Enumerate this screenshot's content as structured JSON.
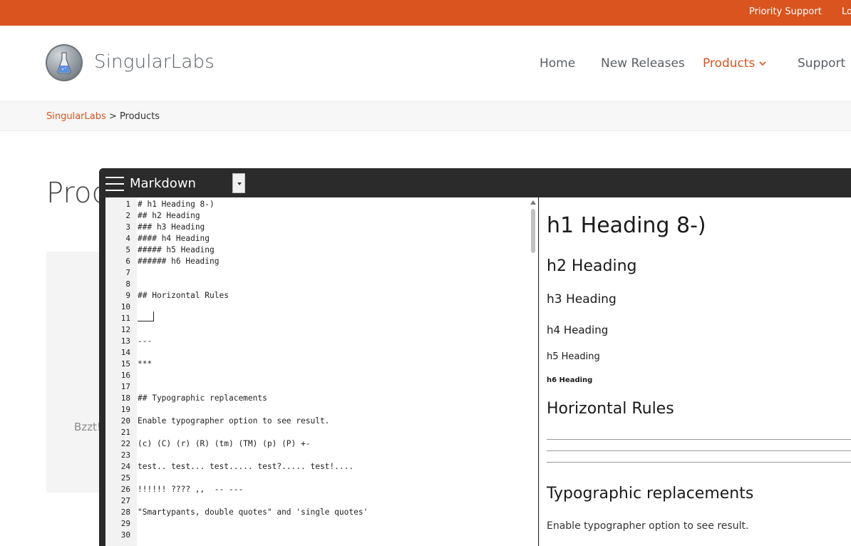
{
  "topbar": {
    "priority_support": "Priority Support",
    "login_partial": "Lo"
  },
  "header": {
    "brand": "SingularLabs",
    "nav": {
      "home": "Home",
      "new_releases": "New Releases",
      "products": "Products",
      "support": "Support"
    }
  },
  "breadcrumb": {
    "home": "SingularLabs",
    "separator": " > ",
    "current": "Products"
  },
  "page": {
    "title_partial": "Prod",
    "bzzt_partial": "Bzzt!"
  },
  "editor": {
    "title": "Markdown",
    "line_numbers": [
      "1",
      "2",
      "3",
      "4",
      "5",
      "6",
      "7",
      "8",
      "9",
      "10",
      "11",
      "12",
      "13",
      "14",
      "15",
      "16",
      "17",
      "18",
      "19",
      "20",
      "21",
      "22",
      "23",
      "24",
      "25",
      "26",
      "27",
      "28",
      "29",
      "30"
    ],
    "lines": [
      "# h1 Heading 8-)",
      "## h2 Heading",
      "### h3 Heading",
      "#### h4 Heading",
      "##### h5 Heading",
      "###### h6 Heading",
      "",
      "",
      "## Horizontal Rules",
      "",
      "",
      "",
      "---",
      "",
      "***",
      "",
      "",
      "## Typographic replacements",
      "",
      "Enable typographer option to see result.",
      "",
      "(c) (C) (r) (R) (tm) (TM) (p) (P) +-",
      "",
      "test.. test... test..... test?..... test!....",
      "",
      "!!!!!! ???? ,,  -- ---",
      "",
      "\"Smartypants, double quotes\" and 'single quotes'",
      "",
      ""
    ],
    "preview": {
      "h1": "h1 Heading 8-)",
      "h2": "h2 Heading",
      "h3": "h3 Heading",
      "h4": "h4 Heading",
      "h5": "h5 Heading",
      "h6": "h6 Heading",
      "horizontal_rules": "Horizontal Rules",
      "typographic": "Typographic replacements",
      "typographic_text": "Enable typographer option to see result."
    }
  },
  "colors": {
    "accent": "#d9541e",
    "editor_bg": "#2a2a2a"
  }
}
